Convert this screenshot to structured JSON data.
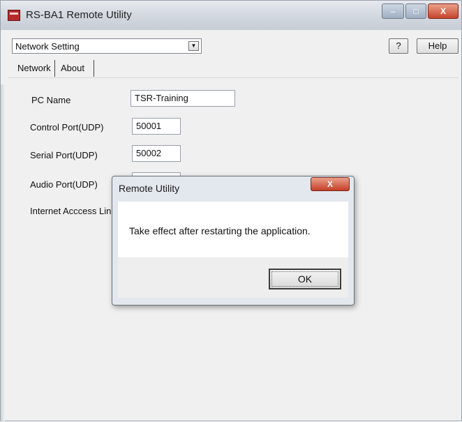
{
  "window": {
    "title": "RS-BA1 Remote Utility",
    "minimize_glyph": "–",
    "maximize_glyph": "□",
    "close_glyph": "X"
  },
  "toolbar": {
    "mode_select_value": "Network Setting",
    "dropdown_arrow": "▼",
    "question_label": "?",
    "help_label": "Help"
  },
  "tabs": [
    {
      "label": "Network"
    },
    {
      "label": "About"
    }
  ],
  "form": {
    "pc_name_label": "PC Name",
    "pc_name_value": "TSR-Training",
    "control_port_label": "Control Port(UDP)",
    "control_port_value": "50001",
    "serial_port_label": "Serial Port(UDP)",
    "serial_port_value": "50002",
    "audio_port_label": "Audio Port(UDP)",
    "audio_port_value": "",
    "internet_label": "Internet Acccess Lin"
  },
  "dialog": {
    "title": "Remote Utility",
    "close_glyph": "X",
    "message": "Take effect after restarting the application.",
    "ok_label": "OK"
  },
  "colors": {
    "close_red": "#c43f28",
    "window_bg": "#f0f0f0"
  }
}
